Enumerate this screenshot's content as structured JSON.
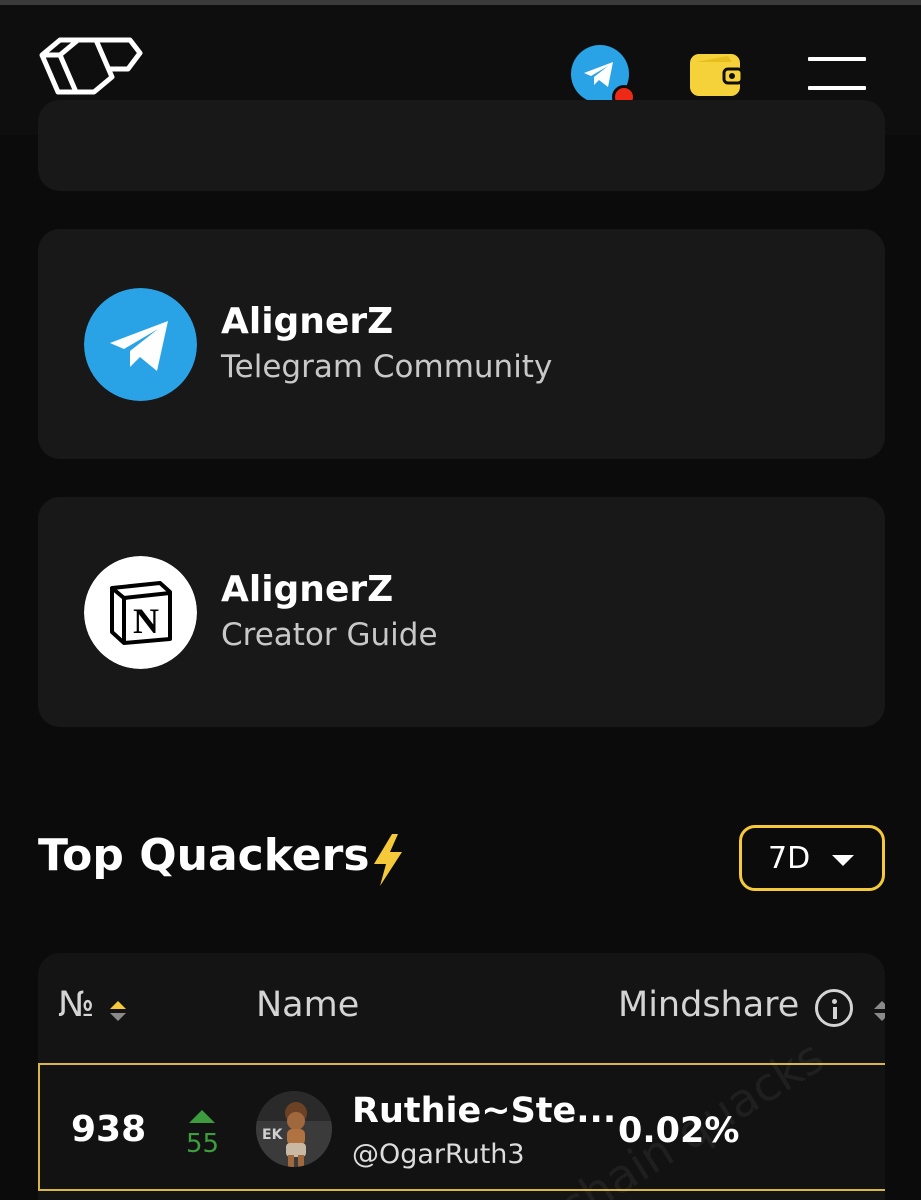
{
  "header": {
    "logo": "logo-icon",
    "telegram_icon": "telegram-icon",
    "wallet_icon": "wallet-icon",
    "menu_icon": "hamburger-menu-icon",
    "colors": {
      "telegram_blue": "#2aa3e6",
      "wallet_yellow": "#f5d13a",
      "notification_red": "#ee2a16"
    }
  },
  "links": [
    {
      "title": "AlignerZ",
      "subtitle": "Telegram Community",
      "icon": "telegram-icon"
    },
    {
      "title": "AlignerZ",
      "subtitle": "Creator Guide",
      "icon": "notion-icon"
    }
  ],
  "leaderboard": {
    "title": "Top Quackers",
    "title_icon": "lightning-icon",
    "period": "7D",
    "columns": {
      "rank": "№",
      "name": "Name",
      "mindshare": "Mindshare"
    },
    "rows": [
      {
        "rank": "938",
        "change": "55",
        "change_direction": "up",
        "name": "Ruthie~Ste...",
        "handle": "@OgarRuth3",
        "mindshare": "0.02%"
      }
    ],
    "colors": {
      "accent": "#f5c93a",
      "up": "#3d9c3d"
    }
  }
}
